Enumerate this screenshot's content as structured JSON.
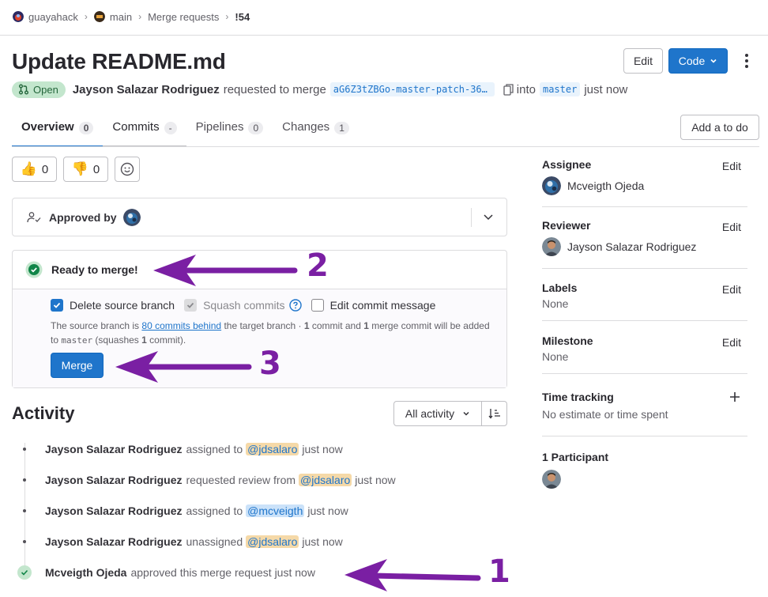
{
  "breadcrumb": {
    "group": "guayahack",
    "project": "main",
    "section": "Merge requests",
    "current": "!54"
  },
  "header": {
    "title": "Update README.md",
    "edit_label": "Edit",
    "code_label": "Code"
  },
  "meta": {
    "status": "Open",
    "author": "Jayson Salazar Rodriguez",
    "requested_text": "requested to merge",
    "source_branch": "aG6Z3tZBGo-master-patch-36…",
    "into_text": "into",
    "target_branch": "master",
    "time": "just now"
  },
  "tabs": [
    {
      "label": "Overview",
      "count": "0"
    },
    {
      "label": "Commits",
      "count": "-"
    },
    {
      "label": "Pipelines",
      "count": "0"
    },
    {
      "label": "Changes",
      "count": "1"
    }
  ],
  "todo_label": "Add a to do",
  "awards": {
    "thumbs_up": "0",
    "thumbs_down": "0"
  },
  "approval": {
    "label": "Approved by"
  },
  "merge_widget": {
    "status": "Ready to merge!",
    "delete_source": "Delete source branch",
    "squash": "Squash commits",
    "edit_message": "Edit commit message",
    "msg_part1": "The source branch is ",
    "msg_link": "80 commits behind",
    "msg_part2": " the target branch · ",
    "msg_commits_n": "1",
    "msg_part3": " commit and ",
    "msg_merge_n": "1",
    "msg_part4": " merge commit will be added to ",
    "msg_target": "master",
    "msg_part5": " (squashes ",
    "msg_squash_n": "1",
    "msg_part6": " commit).",
    "merge_button": "Merge"
  },
  "activity": {
    "title": "Activity",
    "filter": "All activity",
    "notes": [
      {
        "author": "Jayson Salazar Rodriguez",
        "action": "assigned to",
        "mention": "@jdsalaro",
        "time": "just now"
      },
      {
        "author": "Jayson Salazar Rodriguez",
        "action": "requested review from",
        "mention": "@jdsalaro",
        "time": "just now"
      },
      {
        "author": "Jayson Salazar Rodriguez",
        "action": "assigned to",
        "mention": "@mcveigth",
        "time": "just now"
      },
      {
        "author": "Jayson Salazar Rodriguez",
        "action": "unassigned",
        "mention": "@jdsalaro",
        "time": "just now"
      },
      {
        "author": "Mcveigth Ojeda",
        "action": "approved this merge request just now"
      }
    ]
  },
  "sidebar": {
    "assignee_label": "Assignee",
    "assignee": "Mcveigth Ojeda",
    "reviewer_label": "Reviewer",
    "reviewer": "Jayson Salazar Rodriguez",
    "labels_label": "Labels",
    "labels_value": "None",
    "milestone_label": "Milestone",
    "milestone_value": "None",
    "time_label": "Time tracking",
    "time_value": "No estimate or time spent",
    "participants_label": "1 Participant",
    "edit": "Edit"
  },
  "annotations": [
    "1",
    "2",
    "3"
  ],
  "colors": {
    "accent": "#1f75cb",
    "success": "#108548",
    "annotation": "#7a1fa3"
  }
}
